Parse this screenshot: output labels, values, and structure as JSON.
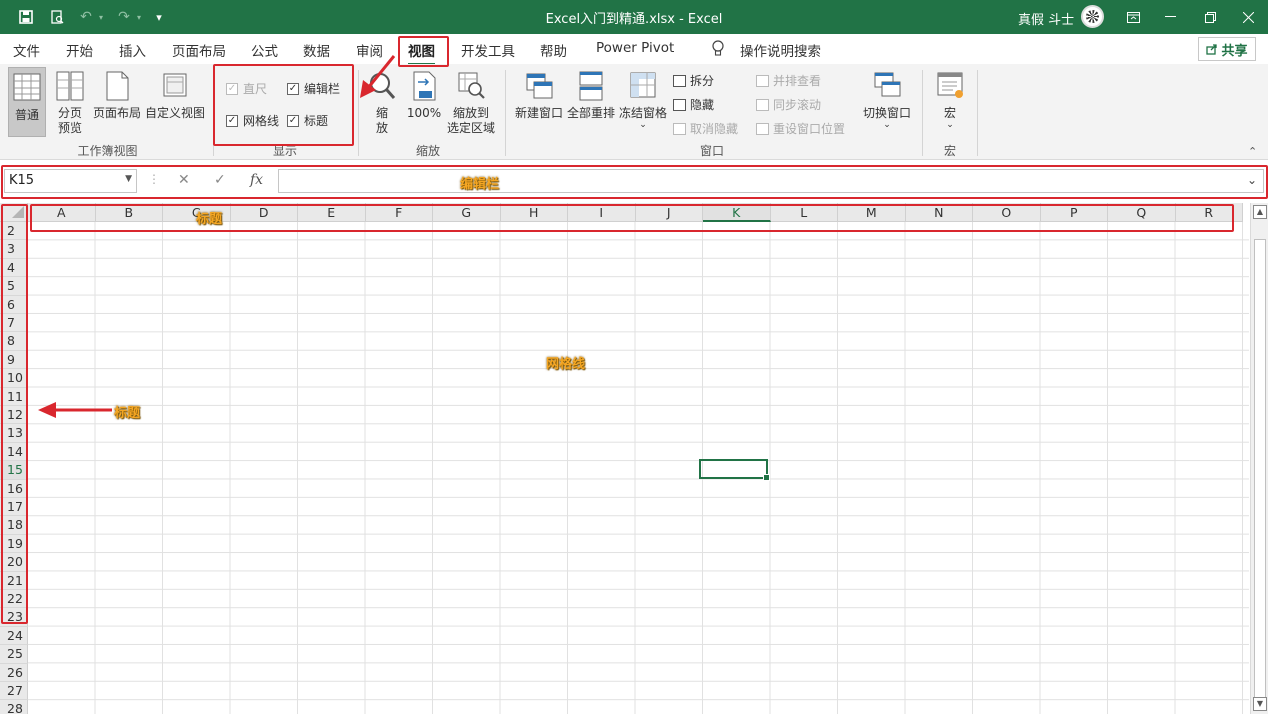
{
  "titlebar": {
    "title": "Excel入门到精通.xlsx  -  Excel",
    "user": "真假 斗士",
    "qat_more": "▾"
  },
  "menu": {
    "tabs": [
      "文件",
      "开始",
      "插入",
      "页面布局",
      "公式",
      "数据",
      "审阅",
      "视图",
      "开发工具",
      "帮助",
      "Power Pivot"
    ],
    "active_tab": "视图",
    "search_label": "操作说明搜索",
    "share_label": "共享"
  },
  "ribbon": {
    "workbook_views": {
      "label": "工作簿视图",
      "normal": "普通",
      "page_break_1": "分页",
      "page_break_2": "预览",
      "page_layout": "页面布局",
      "custom_views": "自定义视图"
    },
    "show": {
      "label": "显示",
      "ruler": "直尺",
      "formula_bar": "编辑栏",
      "gridlines": "网格线",
      "headings": "标题",
      "ruler_checked": true,
      "formula_bar_checked": true,
      "gridlines_checked": true,
      "headings_checked": true
    },
    "zoom": {
      "label": "缩放",
      "zoom_1": "缩",
      "zoom_2": "放",
      "hundred": "100%",
      "zoom_selection_1": "缩放到",
      "zoom_selection_2": "选定区域"
    },
    "window": {
      "label": "窗口",
      "new_window": "新建窗口",
      "arrange_all": "全部重排",
      "freeze_panes": "冻结窗格",
      "split": "拆分",
      "hide": "隐藏",
      "unhide": "取消隐藏",
      "view_side_by_side": "并排查看",
      "sync_scroll": "同步滚动",
      "reset_position": "重设窗口位置",
      "switch_windows": "切换窗口"
    },
    "macros": {
      "label": "宏",
      "macro": "宏"
    }
  },
  "formula_bar": {
    "name_box": "K15",
    "cancel": "✕",
    "enter": "✓",
    "fx": "fx",
    "value": ""
  },
  "grid": {
    "columns": [
      "A",
      "B",
      "C",
      "D",
      "E",
      "F",
      "G",
      "H",
      "I",
      "J",
      "K",
      "L",
      "M",
      "N",
      "O",
      "P",
      "Q",
      "R"
    ],
    "rows": [
      "2",
      "3",
      "4",
      "5",
      "6",
      "7",
      "8",
      "9",
      "10",
      "11",
      "12",
      "13",
      "14",
      "15",
      "16",
      "17",
      "18",
      "19",
      "20",
      "21",
      "22",
      "23",
      "24",
      "25",
      "26",
      "27",
      "28"
    ],
    "selected_column": "K",
    "selected_row": "15"
  },
  "annotations": {
    "formula_bar_label": "编辑栏",
    "column_headings_label": "标题",
    "gridlines_label": "网格线",
    "row_headings_label": "标题"
  }
}
